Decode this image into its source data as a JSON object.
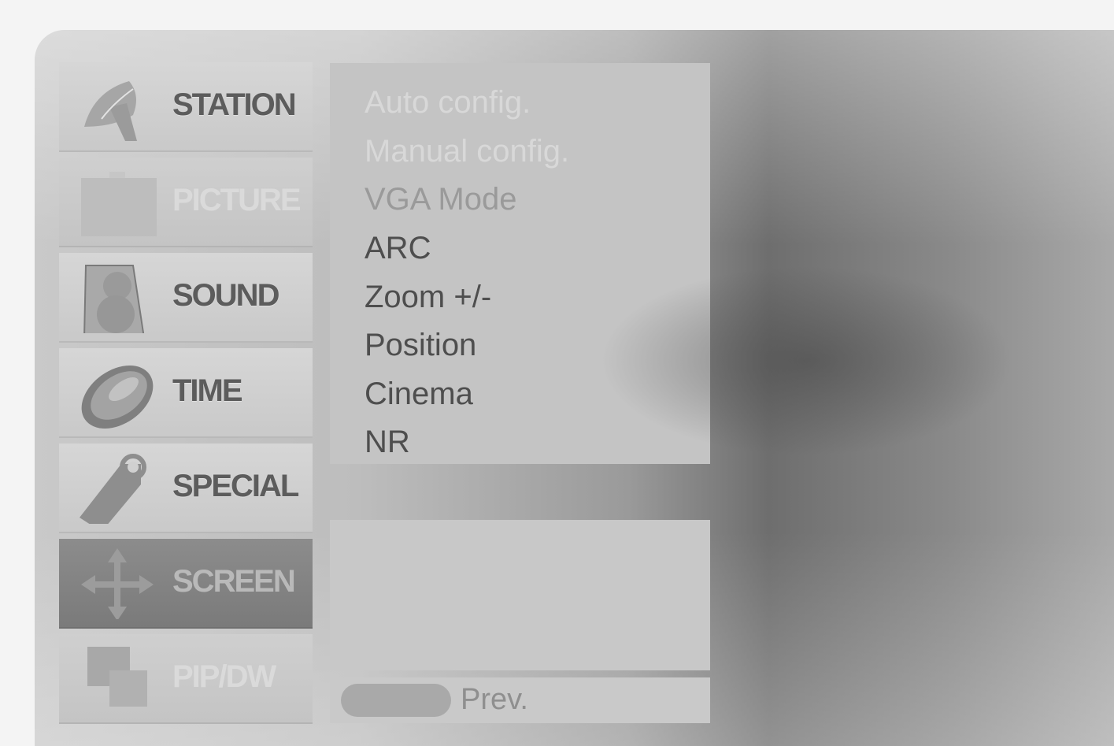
{
  "main_menu": {
    "items": [
      {
        "label": "STATION",
        "icon": "satellite-dish-icon",
        "state": "normal"
      },
      {
        "label": "PICTURE",
        "icon": "picture-icon",
        "state": "dim"
      },
      {
        "label": "SOUND",
        "icon": "speaker-icon",
        "state": "normal"
      },
      {
        "label": "TIME",
        "icon": "clock-icon",
        "state": "normal"
      },
      {
        "label": "SPECIAL",
        "icon": "tag-icon",
        "state": "normal"
      },
      {
        "label": "SCREEN",
        "icon": "move-arrows-icon",
        "state": "selected"
      },
      {
        "label": "PIP/DW",
        "icon": "pip-icon",
        "state": "dim"
      }
    ]
  },
  "submenu": {
    "items": [
      {
        "label": "Auto config.",
        "state": "dim"
      },
      {
        "label": "Manual config.",
        "state": "dim"
      },
      {
        "label": "VGA Mode",
        "state": "semi"
      },
      {
        "label": "ARC",
        "state": "normal"
      },
      {
        "label": "Zoom +/-",
        "state": "normal"
      },
      {
        "label": "Position",
        "state": "normal"
      },
      {
        "label": "Cinema",
        "state": "normal"
      },
      {
        "label": "NR",
        "state": "normal"
      }
    ]
  },
  "navbar": {
    "prev_label": "Prev."
  },
  "colors": {
    "panel": "#c4c4c4",
    "text": "#4e4e4e",
    "selected_item": "#7f7f7f"
  }
}
